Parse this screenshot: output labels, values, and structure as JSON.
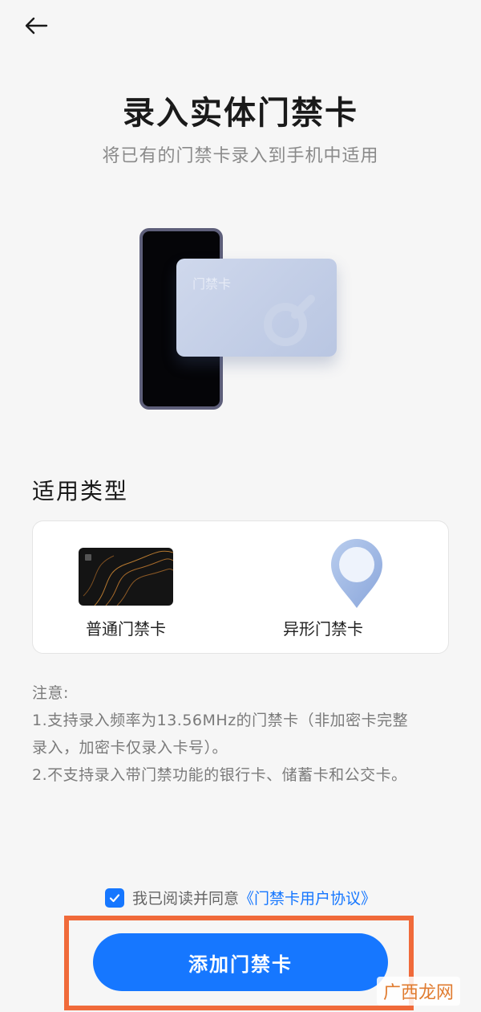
{
  "header": {
    "back_icon": "arrow-left-icon",
    "title": "录入实体门禁卡",
    "subtitle": "将已有的门禁卡录入到手机中适用"
  },
  "illustration": {
    "card_label": "门禁卡"
  },
  "types": {
    "section_title": "适用类型",
    "items": [
      {
        "label": "普通门禁卡",
        "icon": "black-card-icon"
      },
      {
        "label": "异形门禁卡",
        "icon": "map-pin-tag-icon"
      }
    ]
  },
  "notice": {
    "heading": "注意:",
    "line1": "1.支持录入频率为13.56MHz的门禁卡（非加密卡完整",
    "line2": "录入，加密卡仅录入卡号）。",
    "line3": "2.不支持录入带门禁功能的银行卡、储蓄卡和公交卡。"
  },
  "agreement": {
    "checked": true,
    "text": "我已阅读并同意",
    "link": "《门禁卡用户协议》"
  },
  "primary_button": {
    "label": "添加门禁卡"
  },
  "watermark": {
    "text": "广西龙网"
  },
  "colors": {
    "accent": "#1677ff",
    "highlight_frame": "#f06a3a"
  }
}
